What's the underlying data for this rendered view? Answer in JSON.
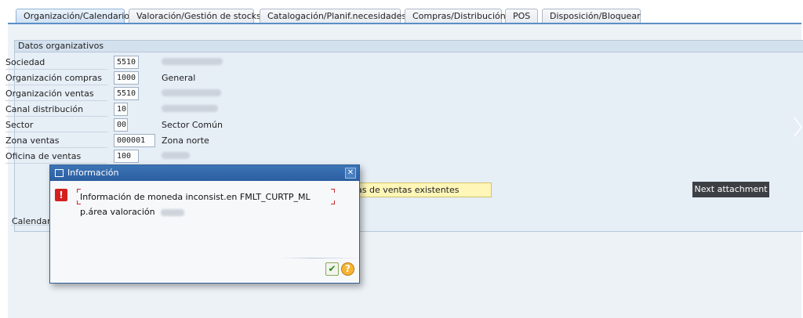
{
  "tabs": [
    {
      "label": "Organización/Calendario",
      "active": true
    },
    {
      "label": "Valoración/Gestión de stocks",
      "active": false
    },
    {
      "label": "Catalogación/Planif.necesidades",
      "active": false
    },
    {
      "label": "Compras/Distribución",
      "active": false
    },
    {
      "label": "POS",
      "active": false
    },
    {
      "label": "Disposición/Bloquear",
      "active": false
    }
  ],
  "group": {
    "title": "Datos organizativos"
  },
  "fields": [
    {
      "label": "Sociedad",
      "value": "5510",
      "description": ""
    },
    {
      "label": "Organización compras",
      "value": "1000",
      "description": "General"
    },
    {
      "label": "Organización ventas",
      "value": "5510",
      "description": ""
    },
    {
      "label": "Canal distribución",
      "value": "10",
      "description": ""
    },
    {
      "label": "Sector",
      "value": "00",
      "description": "Sector Común"
    },
    {
      "label": "Zona ventas",
      "value": "000001",
      "description": "Zona norte"
    },
    {
      "label": "Oficina de ventas",
      "value": "100",
      "description": ""
    }
  ],
  "buttons": {
    "existing_sales": "as de ventas existentes",
    "next_attachment": "Next attachment"
  },
  "calendar": {
    "label": "Calendario"
  },
  "dialog": {
    "title": "Información",
    "close": "✕",
    "message_line1": "Información de moneda inconsist.en FMLT_CURTP_ML",
    "message_line2": "p.área valoración",
    "ok_symbol": "✔",
    "help_symbol": "?"
  },
  "colors": {
    "accent": "#2b5ea0",
    "error": "#d61f1f",
    "highlight": "#fff6b8"
  },
  "icons": {
    "error": "error-icon",
    "close": "close-icon",
    "ok": "checkmark-icon",
    "help": "help-icon",
    "dialog": "window-icon"
  }
}
